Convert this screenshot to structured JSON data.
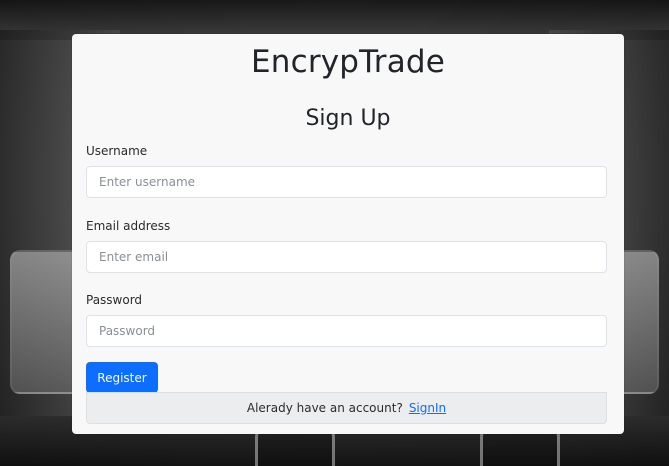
{
  "app": {
    "brand": "EncrypTrade",
    "title": "Sign Up"
  },
  "form": {
    "username": {
      "label": "Username",
      "placeholder": "Enter username",
      "value": ""
    },
    "email": {
      "label": "Email address",
      "placeholder": "Enter email",
      "value": ""
    },
    "password": {
      "label": "Password",
      "placeholder": "Password",
      "value": ""
    },
    "register_label": "Register"
  },
  "footer": {
    "text": "Alerady have an account?",
    "link_text": "SignIn"
  },
  "colors": {
    "primary": "#0d6efd",
    "card_bg": "#f8f8f9",
    "text": "#212529",
    "footer_bg": "#ecedee"
  },
  "icons": {
    "background": "bus-interior-photo"
  }
}
